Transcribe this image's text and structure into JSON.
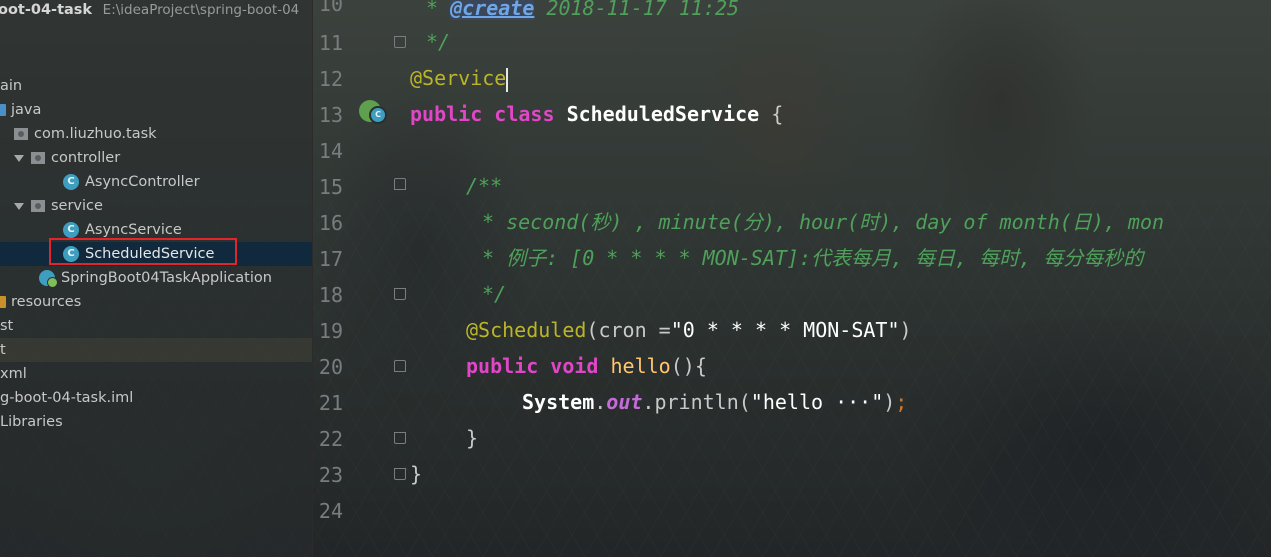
{
  "project": {
    "name": "oot-04-task",
    "path": "E:\\ideaProject\\spring-boot-04",
    "tree": [
      {
        "label": "ain",
        "kind": "text"
      },
      {
        "label": "java",
        "kind": "folder-blue"
      },
      {
        "label": "com.liuzhuo.task",
        "kind": "package"
      },
      {
        "label": "controller",
        "kind": "package",
        "expanded": true
      },
      {
        "label": "AsyncController",
        "kind": "class"
      },
      {
        "label": "service",
        "kind": "package",
        "expanded": true
      },
      {
        "label": "AsyncService",
        "kind": "class"
      },
      {
        "label": "ScheduledService",
        "kind": "class",
        "selected": true
      },
      {
        "label": "SpringBoot04TaskApplication",
        "kind": "app"
      },
      {
        "label": "resources",
        "kind": "folder-orange"
      },
      {
        "label": "st",
        "kind": "text"
      },
      {
        "label": "t",
        "kind": "text"
      },
      {
        "label": "xml",
        "kind": "text"
      },
      {
        "label": "g-boot-04-task.iml",
        "kind": "text"
      },
      {
        "label": "Libraries",
        "kind": "text"
      }
    ]
  },
  "editor": {
    "lines": [
      {
        "num": "10",
        "text": "* @create 2018-11-17 11:25"
      },
      {
        "num": "11",
        "text": "*/"
      },
      {
        "num": "12",
        "text": "@Service"
      },
      {
        "num": "13",
        "text": "public class ScheduledService {"
      },
      {
        "num": "14",
        "text": ""
      },
      {
        "num": "15",
        "text": "/**"
      },
      {
        "num": "16",
        "text": "* second(秒) , minute(分), hour(时), day of month(日), mon"
      },
      {
        "num": "17",
        "text": "* 例子: [0 * * * * MON-SAT]:代表每月, 每日, 每时, 每分每秒的"
      },
      {
        "num": "18",
        "text": "*/"
      },
      {
        "num": "19",
        "text": "@Scheduled(cron =\"0 * * * * MON-SAT\")"
      },
      {
        "num": "20",
        "text": "public void hello(){"
      },
      {
        "num": "21",
        "text": "System.out.println(\"hello ···\");"
      },
      {
        "num": "22",
        "text": "}"
      },
      {
        "num": "23",
        "text": "}"
      },
      {
        "num": "24",
        "text": ""
      }
    ],
    "tokens": {
      "l10_star": "* ",
      "l10_tag": "@create",
      "l10_rest": " 2018-11-17 11:25",
      "l11": "*/",
      "l12_ann": "@Service",
      "l13_public": "public",
      "l13_class": "class",
      "l13_name": "ScheduledService",
      "l13_brace": " {",
      "l15": "/**",
      "l16": "* second(秒) , minute(分), hour(时), day of month(日), mon",
      "l17": "* 例子: [0 * * * * MON-SAT]:代表每月, 每日, 每时, 每分每秒的",
      "l18": "*/",
      "l19_ann": "@Scheduled",
      "l19_paren": "(cron =",
      "l19_str": "\"0 * * * * MON-SAT\"",
      "l19_close": ")",
      "l20_public": "public",
      "l20_void": "void",
      "l20_name": "hello",
      "l20_rest": "(){",
      "l21_system": "System",
      "l21_dot1": ".",
      "l21_out": "out",
      "l21_println": ".println(",
      "l21_str": "\"hello ···\"",
      "l21_close": ")",
      "l21_semi": ";",
      "l22": "}",
      "l23": "}"
    }
  },
  "colors": {
    "keyword": "#e046c6",
    "annotation": "#bbb529",
    "comment": "#4fa05a",
    "method": "#ffc66d",
    "selection_box": "#e0262a"
  }
}
